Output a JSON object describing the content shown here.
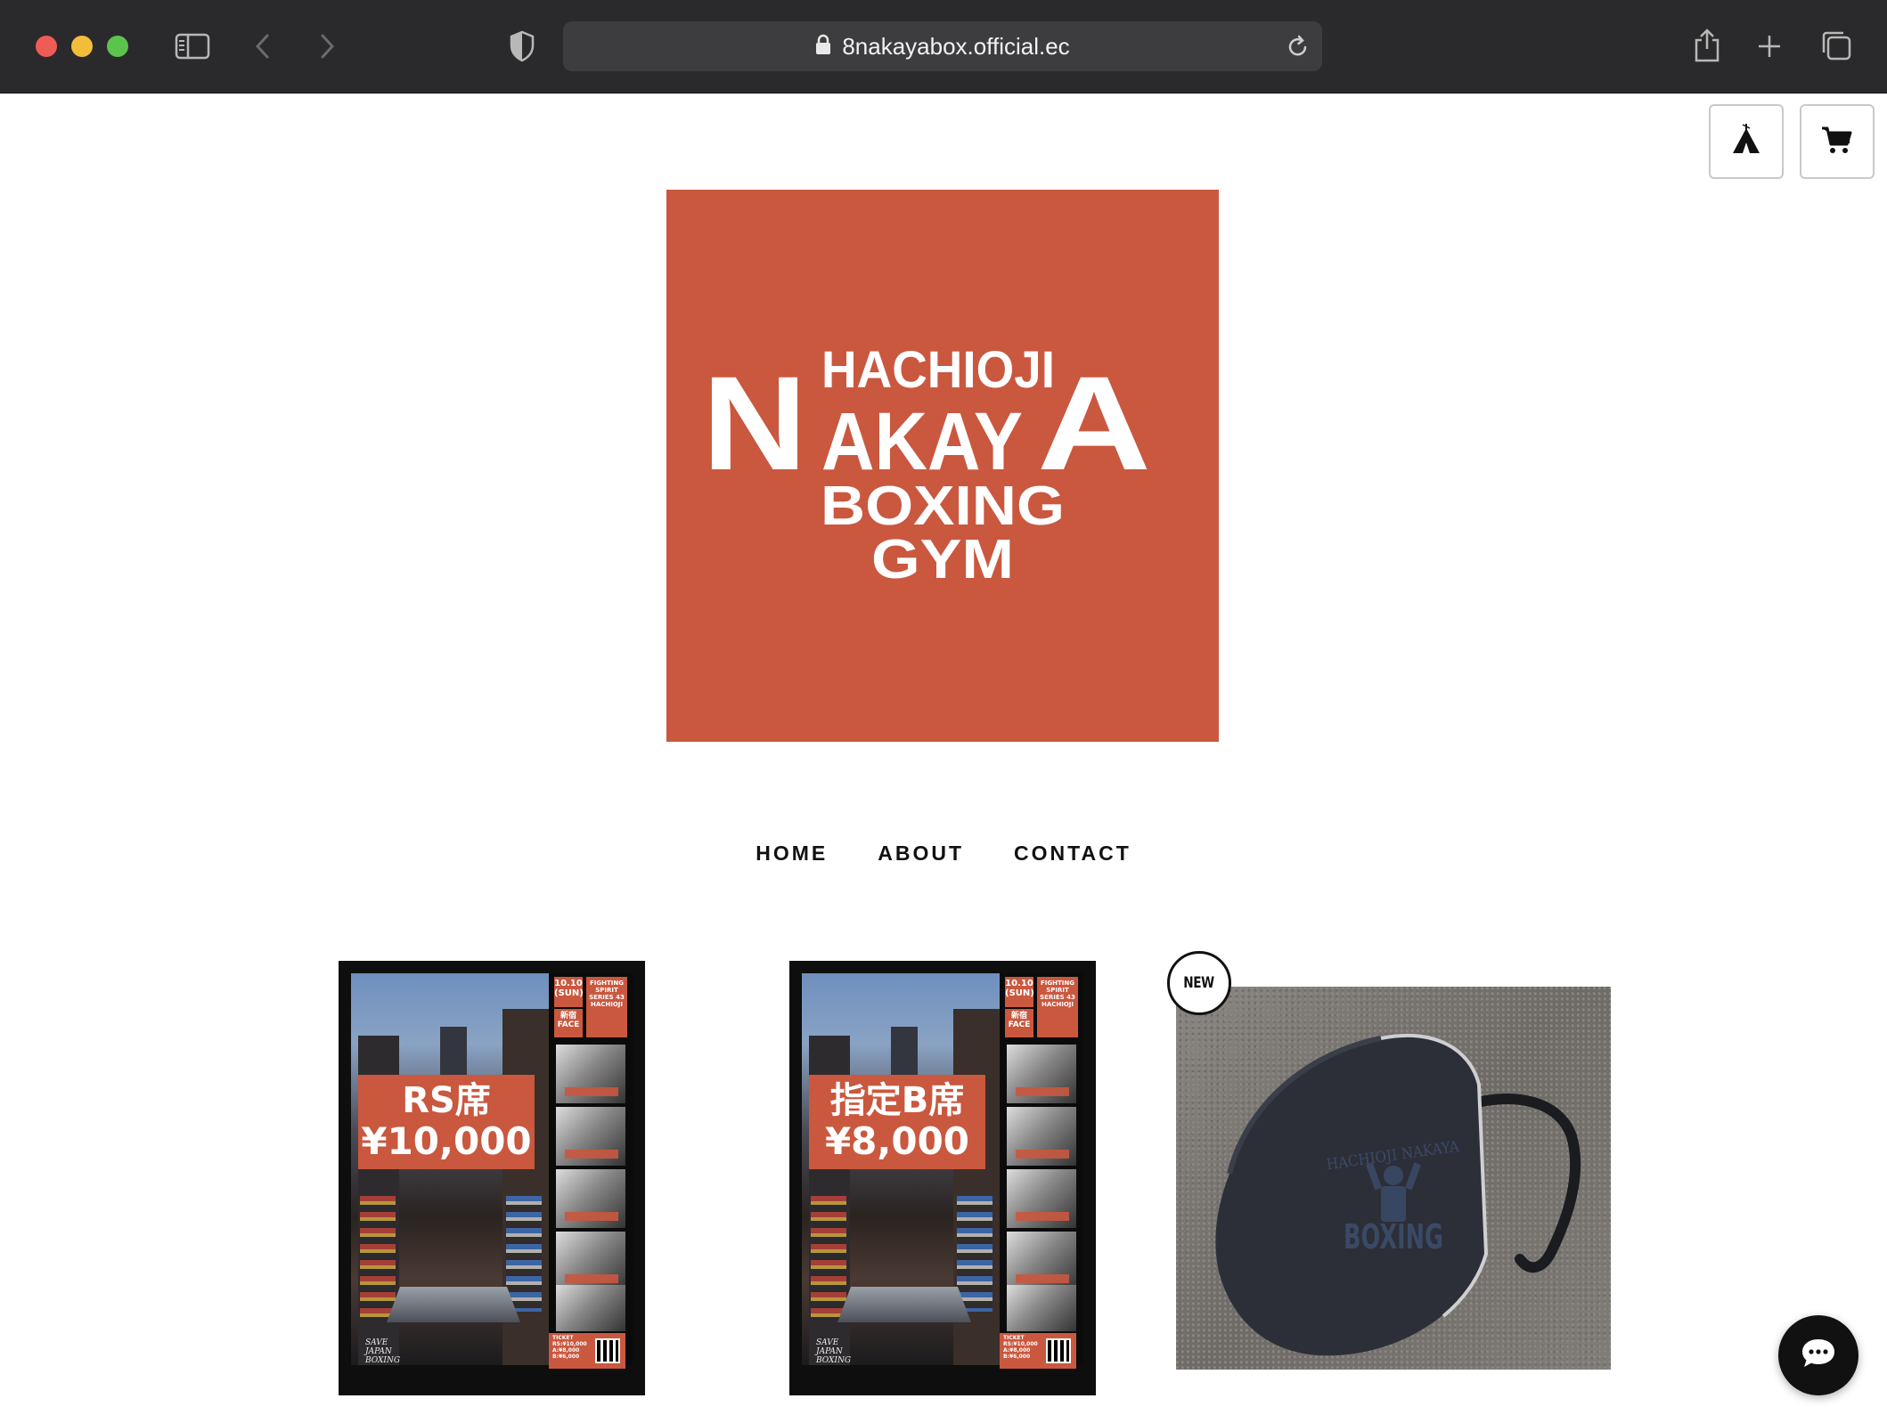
{
  "browser": {
    "url": "8nakayabox.official.ec"
  },
  "header": {
    "logo_lines": [
      "HACHIOJI",
      "NAKAYA",
      "BOXING",
      "GYM"
    ],
    "brand_color": "#c9583f"
  },
  "nav": {
    "items": [
      "HOME",
      "ABOUT",
      "CONTACT"
    ]
  },
  "products": [
    {
      "type": "ticket-poster",
      "price_line1": "RS席",
      "price_line2": "¥10,000"
    },
    {
      "type": "ticket-poster",
      "price_line1": "指定B席",
      "price_line2": "¥8,000"
    },
    {
      "type": "mask",
      "badge": "NEW",
      "print_text": [
        "HACHIOJI NAKAYA",
        "BOXING"
      ]
    }
  ],
  "poster_text": {
    "date": "10.10",
    "day": "(SUN)",
    "venue": "新宿 FACE",
    "series": "FIGHTING SPIRIT SERIES 43 HACHIOJI",
    "ticket_lines": [
      "TICKET",
      "RS:¥10,000",
      "A:¥8,000",
      "B:¥6,000"
    ],
    "slogan": [
      "SAVE",
      "JAPAN",
      "BOXING"
    ]
  },
  "icons": {
    "tent": "tent-icon",
    "cart": "cart-icon",
    "chat": "chat-icon"
  }
}
